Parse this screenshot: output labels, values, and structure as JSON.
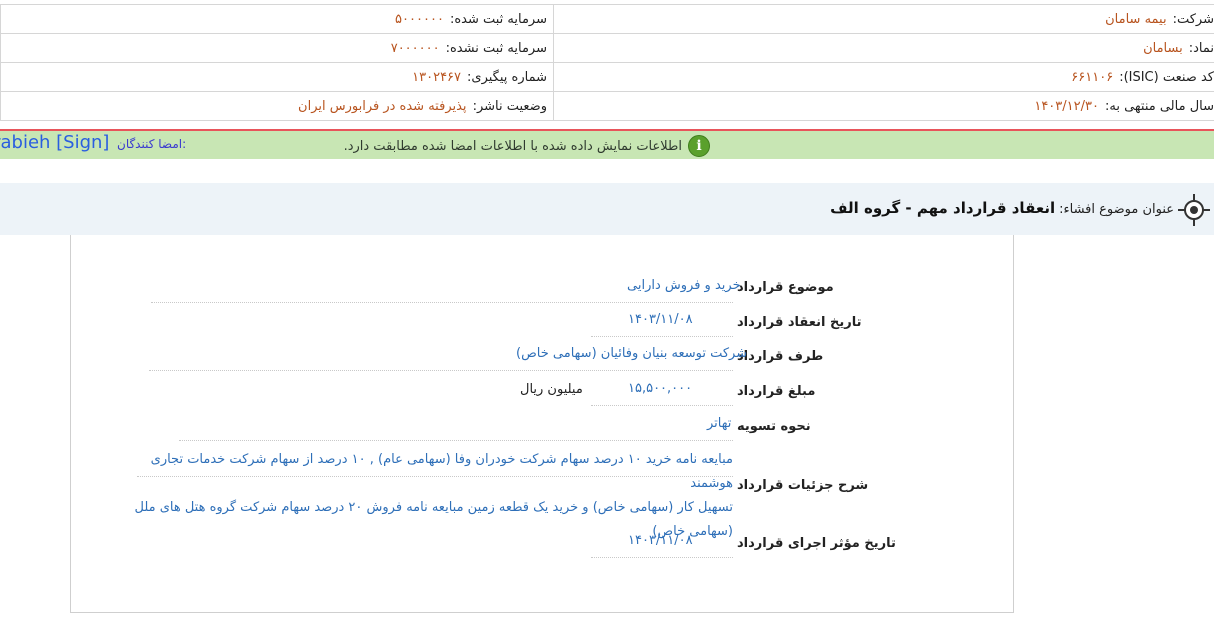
{
  "header": {
    "company_label": "شرکت:",
    "company_value": "بیمه سامان",
    "registered_capital_label": "سرمایه ثبت شده:",
    "registered_capital_value": "۵۰۰۰۰۰۰",
    "symbol_label": "نماد:",
    "symbol_value": "بسامان",
    "unregistered_capital_label": "سرمایه ثبت نشده:",
    "unregistered_capital_value": "۷۰۰۰۰۰۰",
    "isic_label": "کد صنعت (ISIC):",
    "isic_value": "۶۶۱۱۰۶",
    "tracking_label": "شماره پیگیری:",
    "tracking_value": "۱۳۰۲۴۶۷",
    "fiscal_year_label": "سال مالی منتهی به:",
    "fiscal_year_value": "۱۴۰۳/۱۲/۳۰",
    "publisher_status_label": "وضعیت ناشر:",
    "publisher_status_value": "پذیرفته شده در فرابورس ایران"
  },
  "notice": {
    "message": "اطلاعات نمایش داده شده با اطلاعات امضا شده مطابقت دارد.",
    "signers_label": "امضا کنندگان:",
    "signers_value": "rrabieh [Sign]",
    "icon": "info-icon",
    "color": "#c8e6b4"
  },
  "subject": {
    "label": "عنوان موضوع افشاء:",
    "title": "انعقاد قرارداد مهم - گروه الف",
    "icon": "target-icon"
  },
  "contract": {
    "subject_label": "موضوع قرارداد",
    "subject_value": "خرید و فروش دارایی",
    "date_label": "تاریخ انعقاد قرارداد",
    "date_value": "۱۴۰۳/۱۱/۰۸",
    "party_label": "طرف قرارداد",
    "party_value": "شرکت توسعه بنیان وفائیان (سهامی خاص)",
    "amount_label": "مبلغ قرارداد",
    "amount_value": "۱۵,۵۰۰,۰۰۰",
    "amount_unit": "میلیون ریال",
    "settlement_label": "نحوه تسویه",
    "settlement_value": "تهاتر",
    "details_label": "شرح جزئیات قرارداد",
    "details_line1": "مبایعه نامه خرید ۱۰ درصد سهام شرکت خودران وفا (سهامی عام) , ۱۰ درصد از سهام شرکت خدمات تجاری هوشمند",
    "details_line2": "تسهیل کار (سهامی خاص) و خرید یک قطعه زمین مبایعه نامه فروش ۲۰ درصد سهام شرکت گروه هتل های ملل",
    "details_line3": "(سهامی خاص)",
    "effective_date_label": "تاریخ مؤثر اجرای قرارداد",
    "effective_date_value": "۱۴۰۳/۱۱/۰۸"
  }
}
